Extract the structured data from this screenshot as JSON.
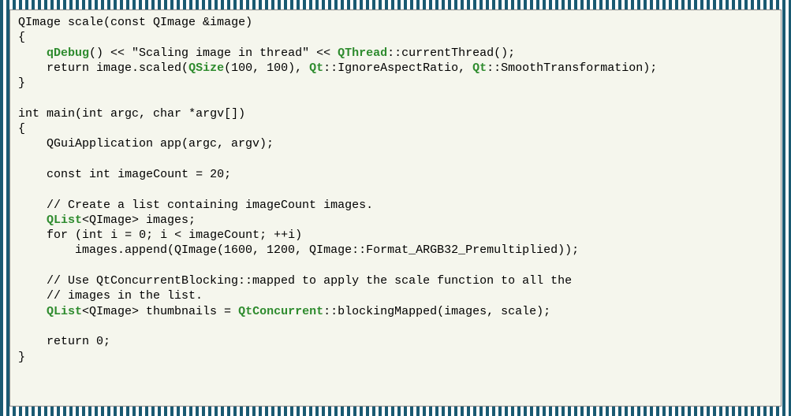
{
  "code_lines": [
    [
      {
        "t": "QImage scale(",
        "c": "plain"
      },
      {
        "t": "const",
        "c": "plain"
      },
      {
        "t": " QImage &image)",
        "c": "plain"
      }
    ],
    [
      {
        "t": "{",
        "c": "plain"
      }
    ],
    [
      {
        "t": "    ",
        "c": "plain"
      },
      {
        "t": "qDebug",
        "c": "link"
      },
      {
        "t": "() << \"Scaling image in thread\" << ",
        "c": "plain"
      },
      {
        "t": "QThread",
        "c": "link"
      },
      {
        "t": "::currentThread();",
        "c": "plain"
      }
    ],
    [
      {
        "t": "    ",
        "c": "plain"
      },
      {
        "t": "return",
        "c": "plain"
      },
      {
        "t": " image.scaled(",
        "c": "plain"
      },
      {
        "t": "QSize",
        "c": "link"
      },
      {
        "t": "(100, 100), ",
        "c": "plain"
      },
      {
        "t": "Qt",
        "c": "link"
      },
      {
        "t": "::IgnoreAspectRatio, ",
        "c": "plain"
      },
      {
        "t": "Qt",
        "c": "link"
      },
      {
        "t": "::SmoothTransformation);",
        "c": "plain"
      }
    ],
    [
      {
        "t": "}",
        "c": "plain"
      }
    ],
    [
      {
        "t": "",
        "c": "plain"
      }
    ],
    [
      {
        "t": "int main(",
        "c": "plain"
      },
      {
        "t": "int",
        "c": "plain"
      },
      {
        "t": " argc, ",
        "c": "plain"
      },
      {
        "t": "char",
        "c": "plain"
      },
      {
        "t": " *argv[])",
        "c": "plain"
      }
    ],
    [
      {
        "t": "{",
        "c": "plain"
      }
    ],
    [
      {
        "t": "    QGuiApplication app(argc, argv);",
        "c": "plain"
      }
    ],
    [
      {
        "t": "",
        "c": "plain"
      }
    ],
    [
      {
        "t": "    ",
        "c": "plain"
      },
      {
        "t": "const",
        "c": "plain"
      },
      {
        "t": " ",
        "c": "plain"
      },
      {
        "t": "int",
        "c": "plain"
      },
      {
        "t": " imageCount = 20;",
        "c": "plain"
      }
    ],
    [
      {
        "t": "",
        "c": "plain"
      }
    ],
    [
      {
        "t": "    // Create a list containing imageCount images.",
        "c": "plain"
      }
    ],
    [
      {
        "t": "    ",
        "c": "plain"
      },
      {
        "t": "QList",
        "c": "link"
      },
      {
        "t": "<QImage> images;",
        "c": "plain"
      }
    ],
    [
      {
        "t": "    ",
        "c": "plain"
      },
      {
        "t": "for",
        "c": "plain"
      },
      {
        "t": " (",
        "c": "plain"
      },
      {
        "t": "int",
        "c": "plain"
      },
      {
        "t": " i = 0; i < imageCount; ++i)",
        "c": "plain"
      }
    ],
    [
      {
        "t": "        images.append(QImage(1600, 1200, QImage::Format_ARGB32_Premultiplied));",
        "c": "plain"
      }
    ],
    [
      {
        "t": "",
        "c": "plain"
      }
    ],
    [
      {
        "t": "    // Use QtConcurrentBlocking::mapped to apply the scale function to all the",
        "c": "plain"
      }
    ],
    [
      {
        "t": "    // images in the list.",
        "c": "plain"
      }
    ],
    [
      {
        "t": "    ",
        "c": "plain"
      },
      {
        "t": "QList",
        "c": "link"
      },
      {
        "t": "<QImage> thumbnails = ",
        "c": "plain"
      },
      {
        "t": "QtConcurrent",
        "c": "link"
      },
      {
        "t": "::blockingMapped(images, scale);",
        "c": "plain"
      }
    ],
    [
      {
        "t": "",
        "c": "plain"
      }
    ],
    [
      {
        "t": "    ",
        "c": "plain"
      },
      {
        "t": "return",
        "c": "plain"
      },
      {
        "t": " 0;",
        "c": "plain"
      }
    ],
    [
      {
        "t": "}",
        "c": "plain"
      }
    ]
  ]
}
